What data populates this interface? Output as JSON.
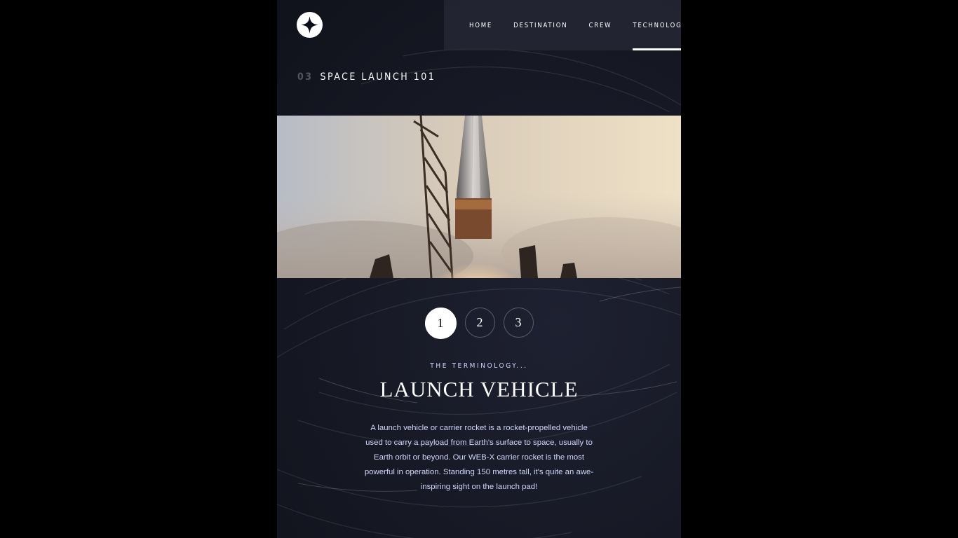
{
  "header": {
    "logo_name": "star-logo-icon",
    "nav": [
      {
        "label": "HOME",
        "active": false
      },
      {
        "label": "DESTINATION",
        "active": false
      },
      {
        "label": "CREW",
        "active": false
      },
      {
        "label": "TECHNOLOGY",
        "active": true
      }
    ]
  },
  "section": {
    "number": "03",
    "title": "SPACE LAUNCH 101"
  },
  "hero_image": {
    "subject": "rocket-launch-image"
  },
  "pager": {
    "items": [
      {
        "label": "1",
        "active": true
      },
      {
        "label": "2",
        "active": false
      },
      {
        "label": "3",
        "active": false
      }
    ]
  },
  "content": {
    "kicker": "THE TERMINOLOGY...",
    "title": "LAUNCH VEHICLE",
    "body": "A launch vehicle or carrier rocket is a rocket-propelled vehicle used to carry a payload from Earth's surface to space, usually to Earth orbit or beyond. Our WEB-X carrier rocket is the most powerful in operation. Standing 150 metres tall, it's quite an awe-inspiring sight on the launch pad!"
  },
  "colors": {
    "background": "#161824",
    "text": "#ffffff",
    "muted_text": "#d0d6f9",
    "nav_panel": "#282a38"
  }
}
